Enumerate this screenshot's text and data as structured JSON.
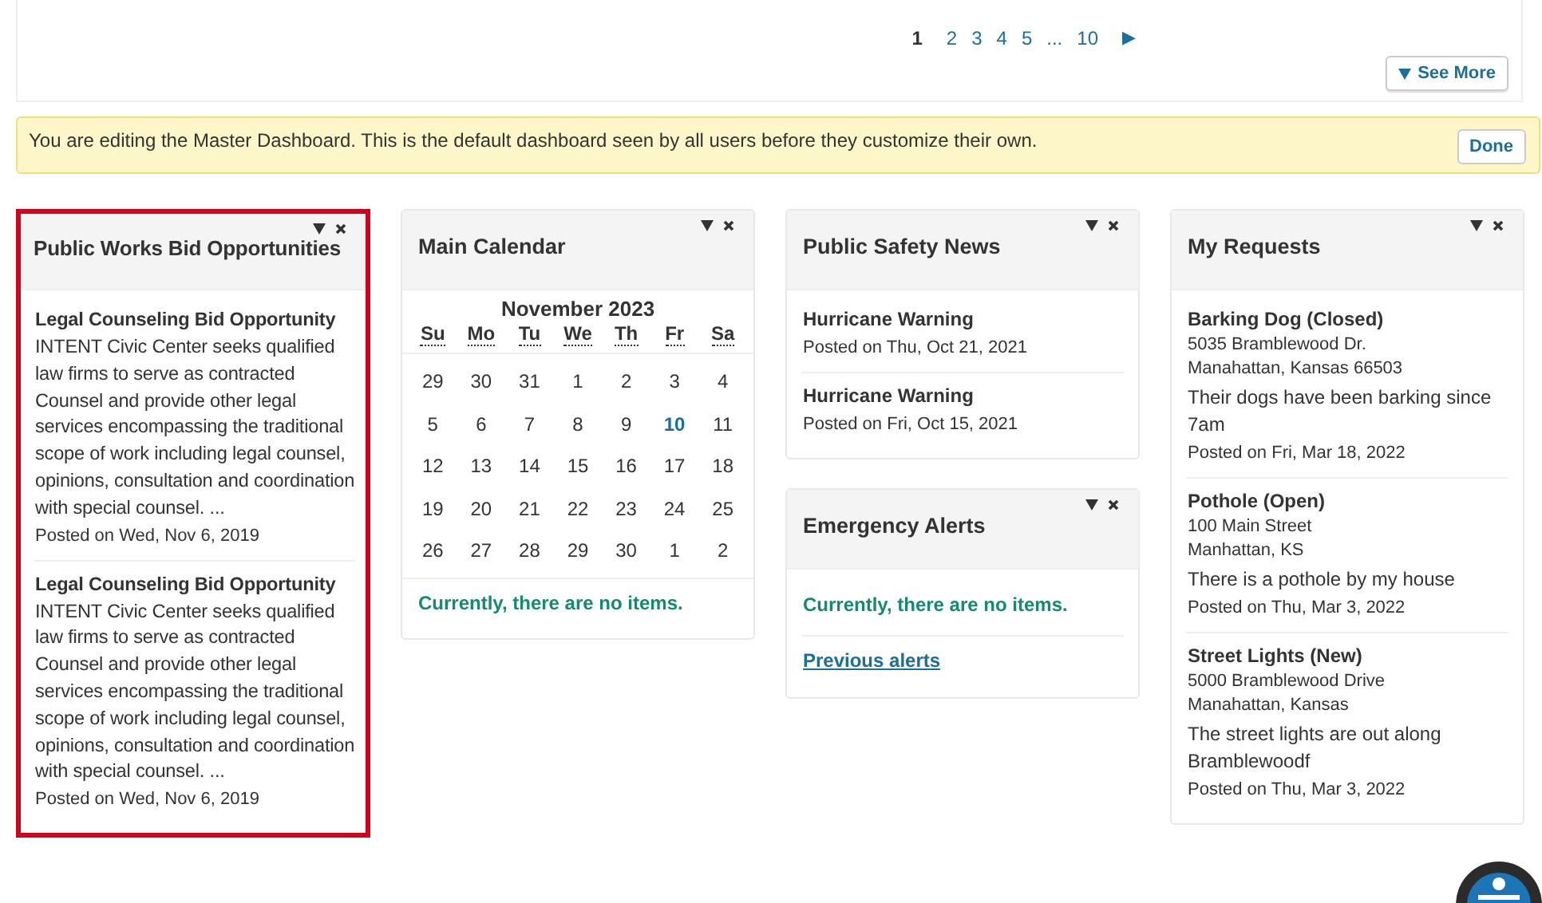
{
  "pager": {
    "pages": [
      {
        "label": "1",
        "selected": true
      },
      {
        "label": "2",
        "selected": false
      },
      {
        "label": "3",
        "selected": false
      },
      {
        "label": "4",
        "selected": false
      },
      {
        "label": "5",
        "selected": false
      },
      {
        "label": "...",
        "selected": false
      },
      {
        "label": "10",
        "selected": false
      }
    ],
    "next": "▶",
    "see_more": "See More"
  },
  "banner": {
    "text": "You are editing the Master Dashboard. This is the default dashboard seen by all users before they customize their own.",
    "button": "Done"
  },
  "columns": [
    {
      "widgets": [
        {
          "kind": "bids",
          "title": "Public Works Bid Opportunities",
          "highlighted": true,
          "items": [
            {
              "title": "Legal Counseling Bid Opportunity",
              "body": "INTENT Civic Center seeks qualified law firms to serve as contracted Counsel and provide other legal services encompassing the traditional scope of work including legal counsel, opinions, consultation and coordination with special counsel. ...",
              "posted": "Posted on Wed, Nov 6, 2019"
            },
            {
              "title": "Legal Counseling Bid Opportunity",
              "body": "INTENT Civic Center seeks qualified law firms to serve as contracted Counsel and provide other legal services encompassing the traditional scope of work including legal counsel, opinions, consultation and coordination with special counsel. ...",
              "posted": "Posted on Wed, Nov 6, 2019"
            }
          ]
        }
      ]
    },
    {
      "widgets": [
        {
          "kind": "calendar",
          "title": "Main Calendar",
          "highlighted": false,
          "month": "November 2023",
          "weekdays": [
            "Su",
            "Mo",
            "Tu",
            "We",
            "Th",
            "Fr",
            "Sa"
          ],
          "weeks": [
            [
              {
                "day": "29",
                "today": false
              },
              {
                "day": "30",
                "today": false
              },
              {
                "day": "31",
                "today": false
              },
              {
                "day": "1",
                "today": false
              },
              {
                "day": "2",
                "today": false
              },
              {
                "day": "3",
                "today": false
              },
              {
                "day": "4",
                "today": false
              }
            ],
            [
              {
                "day": "5",
                "today": false
              },
              {
                "day": "6",
                "today": false
              },
              {
                "day": "7",
                "today": false
              },
              {
                "day": "8",
                "today": false
              },
              {
                "day": "9",
                "today": false
              },
              {
                "day": "10",
                "today": true
              },
              {
                "day": "11",
                "today": false
              }
            ],
            [
              {
                "day": "12",
                "today": false
              },
              {
                "day": "13",
                "today": false
              },
              {
                "day": "14",
                "today": false
              },
              {
                "day": "15",
                "today": false
              },
              {
                "day": "16",
                "today": false
              },
              {
                "day": "17",
                "today": false
              },
              {
                "day": "18",
                "today": false
              }
            ],
            [
              {
                "day": "19",
                "today": false
              },
              {
                "day": "20",
                "today": false
              },
              {
                "day": "21",
                "today": false
              },
              {
                "day": "22",
                "today": false
              },
              {
                "day": "23",
                "today": false
              },
              {
                "day": "24",
                "today": false
              },
              {
                "day": "25",
                "today": false
              }
            ],
            [
              {
                "day": "26",
                "today": false
              },
              {
                "day": "27",
                "today": false
              },
              {
                "day": "28",
                "today": false
              },
              {
                "day": "29",
                "today": false
              },
              {
                "day": "30",
                "today": false
              },
              {
                "day": "1",
                "today": false
              },
              {
                "day": "2",
                "today": false
              }
            ]
          ],
          "empty": "Currently, there are no items."
        }
      ]
    },
    {
      "widgets": [
        {
          "kind": "news",
          "title": "Public Safety News",
          "highlighted": false,
          "items": [
            {
              "title": "Hurricane Warning",
              "posted": "Posted on Thu, Oct 21, 2021"
            },
            {
              "title": "Hurricane Warning",
              "posted": "Posted on Fri, Oct 15, 2021"
            }
          ]
        },
        {
          "kind": "alerts",
          "title": "Emergency Alerts",
          "highlighted": false,
          "empty": "Currently, there are no items.",
          "link": "Previous alerts"
        }
      ]
    },
    {
      "widgets": [
        {
          "kind": "requests",
          "title": "My Requests",
          "highlighted": false,
          "items": [
            {
              "title": "Barking Dog (Closed)",
              "address": [
                "5035 Bramblewood Dr.",
                "Manahattan, Kansas 66503"
              ],
              "body": "Their dogs have been barking since 7am",
              "posted": "Posted on Fri, Mar 18, 2022"
            },
            {
              "title": "Pothole (Open)",
              "address": [
                "100 Main Street",
                "Manhattan, KS"
              ],
              "body": "There is a pothole by my house",
              "posted": "Posted on Thu, Mar 3, 2022"
            },
            {
              "title": "Street Lights (New)",
              "address": [
                "5000 Bramblewood Drive",
                "Manahattan, Kansas"
              ],
              "body": "The street lights are out along Bramblewoodf",
              "posted": "Posted on Thu, Mar 3, 2022"
            }
          ]
        }
      ]
    }
  ]
}
